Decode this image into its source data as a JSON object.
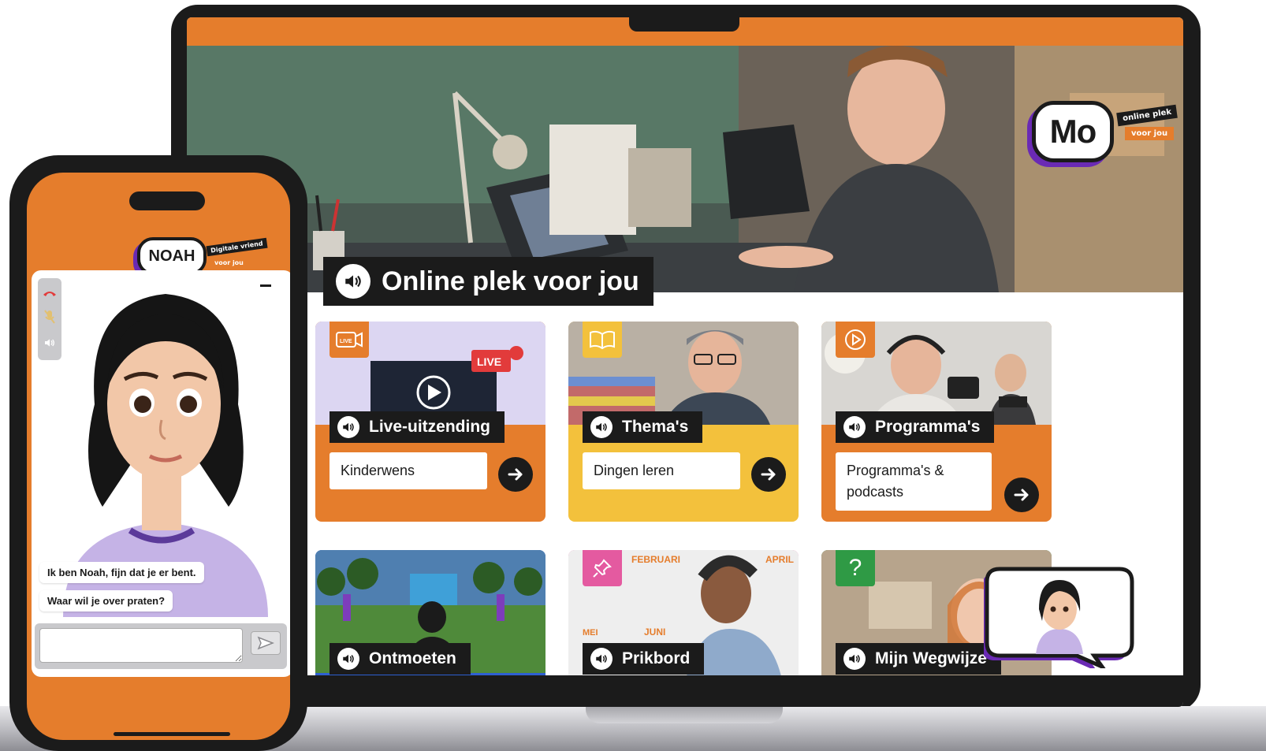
{
  "colors": {
    "brand_orange": "#e57d2c",
    "brand_purple": "#6a2ab4",
    "dark": "#1b1b1b",
    "yellow": "#f3c13c",
    "pink": "#e45aa0",
    "blue": "#2e5fd1"
  },
  "header": {
    "logo": {
      "text": "Mo",
      "tag_top": "online plek",
      "tag_bottom": "voor jou"
    },
    "hero_title": "Online plek voor jou"
  },
  "cards": [
    {
      "title": "Live-uitzending",
      "subtitle": "Kinderwens",
      "icon": "live-camera-icon",
      "badge": "LIVE",
      "bg": "#e57d2c"
    },
    {
      "title": "Thema's",
      "subtitle": "Dingen leren",
      "icon": "book-icon",
      "bg": "#f3c13c"
    },
    {
      "title": "Programma's",
      "subtitle": "Programma's & podcasts",
      "icon": "play-circle-icon",
      "bg": "#e57d2c"
    }
  ],
  "tiles": [
    {
      "title": "Ontmoeten",
      "accent": "#2e5fd1"
    },
    {
      "title": "Prikbord",
      "accent": "#e45aa0",
      "icon": "pin-icon",
      "calendar": [
        "FEBRUARI",
        "APRIL",
        "MEI",
        "JUNI"
      ]
    },
    {
      "title": "Mijn Wegwijze",
      "accent": "#2f9a45",
      "icon": "question-icon",
      "badge": "?"
    }
  ],
  "phone": {
    "logo": {
      "text": "NOAH",
      "tag_top": "Digitale vriend",
      "tag_bottom": "voor jou"
    },
    "messages": [
      "Ik ben Noah, fijn dat je er bent.",
      "Waar wil je over praten?"
    ],
    "input_placeholder": ""
  }
}
